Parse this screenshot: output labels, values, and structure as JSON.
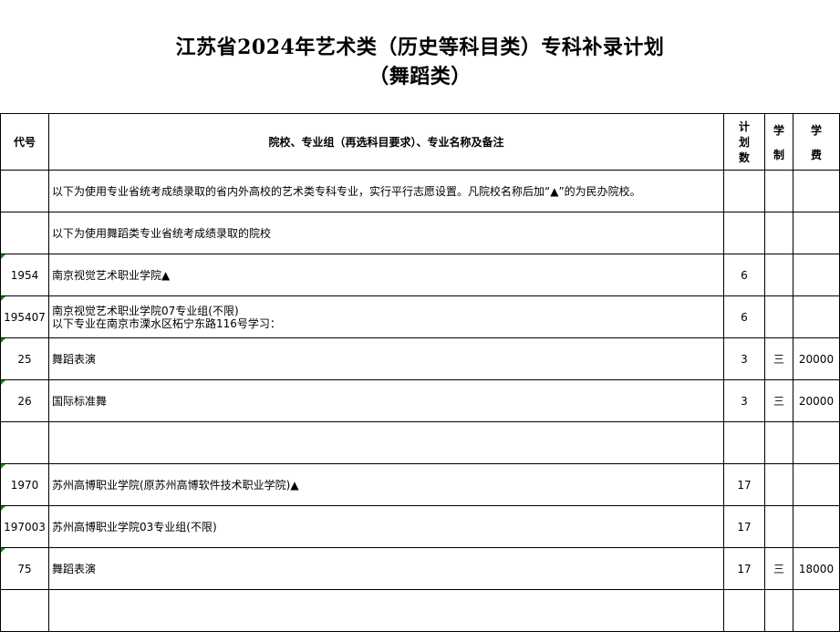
{
  "title": "江苏省2024年艺术类（历史等科目类）专科补录计划",
  "subtitle": "（舞蹈类）",
  "headers": {
    "code": "代号",
    "name": "院校、专业组（再选科目要求）、专业名称及备注",
    "plan": [
      "计",
      "划",
      "数"
    ],
    "years": [
      "学",
      "制"
    ],
    "fee": [
      "学",
      "费"
    ]
  },
  "rows": [
    {
      "code": "",
      "name": [
        "以下为使用专业省统考成绩录取的省内外高校的艺术类专科专业，实行平行志愿设置。凡院校名称后加“▲”的为民办院校。"
      ],
      "plan": "",
      "years": "",
      "fee": ""
    },
    {
      "code": "",
      "name": [
        "以下为使用舞蹈类专业省统考成绩录取的院校"
      ],
      "plan": "",
      "years": "",
      "fee": ""
    },
    {
      "code": "1954",
      "name": [
        "南京视觉艺术职业学院▲"
      ],
      "plan": "6",
      "years": "",
      "fee": ""
    },
    {
      "code": "195407",
      "name": [
        "南京视觉艺术职业学院07专业组(不限)",
        "以下专业在南京市溧水区柘宁东路116号学习："
      ],
      "plan": "6",
      "years": "",
      "fee": ""
    },
    {
      "code": "25",
      "name": [
        "舞蹈表演"
      ],
      "plan": "3",
      "years": "三",
      "fee": "20000"
    },
    {
      "code": "26",
      "name": [
        "国际标准舞"
      ],
      "plan": "3",
      "years": "三",
      "fee": "20000"
    },
    {
      "code": "",
      "name": [
        ""
      ],
      "plan": "",
      "years": "",
      "fee": ""
    },
    {
      "code": "1970",
      "name": [
        "苏州高博职业学院(原苏州高博软件技术职业学院)▲"
      ],
      "plan": "17",
      "years": "",
      "fee": ""
    },
    {
      "code": "197003",
      "name": [
        "苏州高博职业学院03专业组(不限)"
      ],
      "plan": "17",
      "years": "",
      "fee": ""
    },
    {
      "code": "75",
      "name": [
        "舞蹈表演"
      ],
      "plan": "17",
      "years": "三",
      "fee": "18000"
    },
    {
      "code": "",
      "name": [
        ""
      ],
      "plan": "",
      "years": "",
      "fee": ""
    }
  ]
}
